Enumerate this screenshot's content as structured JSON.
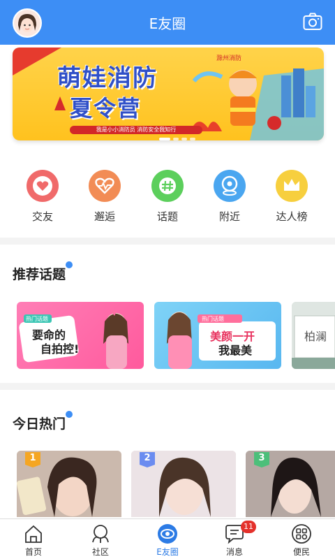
{
  "header": {
    "title": "E友圈",
    "camera_icon": "camera-icon",
    "avatar_icon": "user-avatar"
  },
  "banner": {
    "title_line1": "萌娃消防",
    "title_line2": "夏令营",
    "strip_text": "我是小小消防员 消防安全我知行",
    "logo_text": "滁州消防",
    "active_slide": 0,
    "slide_count": 4
  },
  "menu": [
    {
      "label": "交友",
      "icon": "heart-icon",
      "color": "#f06a6a"
    },
    {
      "label": "邂逅",
      "icon": "heartbeat-icon",
      "color": "#f28c55"
    },
    {
      "label": "话题",
      "icon": "hashtag-icon",
      "color": "#5ccf5c"
    },
    {
      "label": "附近",
      "icon": "location-icon",
      "color": "#4aa6f0"
    },
    {
      "label": "达人榜",
      "icon": "crown-icon",
      "color": "#f7cf3e"
    }
  ],
  "topics_section": {
    "title": "推荐话题"
  },
  "topics": [
    {
      "text_line1": "要命的",
      "text_line2": "自拍控!",
      "tag": "热门话题"
    },
    {
      "text_line1": "美颜一开",
      "text_line2": "我最美",
      "tag": "热门话题"
    },
    {
      "text_line1": "柏澜",
      "text_line2": ""
    }
  ],
  "hot_section": {
    "title": "今日热门"
  },
  "hot": [
    {
      "rank": "1",
      "badge_color": "#f5a623"
    },
    {
      "rank": "2",
      "badge_color": "#6b8cf0"
    },
    {
      "rank": "3",
      "badge_color": "#4cbf7a"
    }
  ],
  "tabs": [
    {
      "label": "首页",
      "icon": "home-icon",
      "active": false
    },
    {
      "label": "社区",
      "icon": "community-icon",
      "active": false
    },
    {
      "label": "E友圈",
      "icon": "eyouquan-icon",
      "active": true
    },
    {
      "label": "消息",
      "icon": "message-icon",
      "active": false,
      "badge": "11"
    },
    {
      "label": "便民",
      "icon": "services-icon",
      "active": false
    }
  ]
}
